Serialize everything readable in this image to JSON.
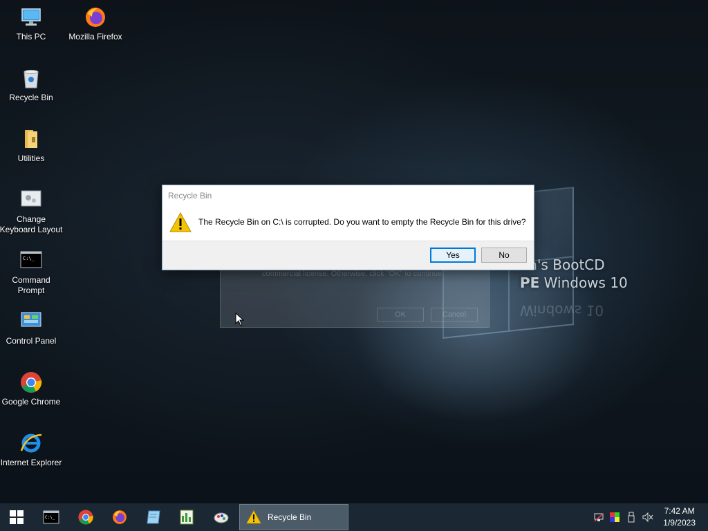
{
  "wallpaper": {
    "line1": "en's BootCD",
    "line2_pe": "PE",
    "line2_rest": " Windows 10",
    "reflection": "Windows 10"
  },
  "ghost_dialog": {
    "text": "EasyBCD Community Edition is freely licensed for non-commercial use. If you are using this software in a commercial environment, please click \"Cancel\" below to purchase a commercial license. Otherwise, click \"OK\" to continue.",
    "ok_label": "OK",
    "cancel_label": "Cancel"
  },
  "desktop_icons": [
    {
      "label": "This PC",
      "icon": "this-pc-icon"
    },
    {
      "label": "Mozilla Firefox",
      "icon": "firefox-icon"
    },
    {
      "label": "Recycle Bin",
      "icon": "recycle-bin-icon"
    },
    {
      "label": "Utilities",
      "icon": "folder-icon"
    },
    {
      "label": "Change Keyboard Layout",
      "icon": "keyboard-layout-icon"
    },
    {
      "label": "Command Prompt",
      "icon": "command-prompt-icon"
    },
    {
      "label": "Control Panel",
      "icon": "control-panel-icon"
    },
    {
      "label": "Google Chrome",
      "icon": "chrome-icon"
    },
    {
      "label": "Internet Explorer",
      "icon": "internet-explorer-icon"
    }
  ],
  "dialog": {
    "title": "Recycle Bin",
    "message": "The Recycle Bin on C:\\ is corrupted. Do you want to empty the Recycle Bin for this drive?",
    "yes_label": "Yes",
    "no_label": "No",
    "icon": "warning-icon"
  },
  "taskbar": {
    "pinned": [
      "start-icon",
      "command-prompt-icon",
      "chrome-icon",
      "firefox-icon",
      "notepad-icon",
      "spreadsheet-icon",
      "paint-icon"
    ],
    "active_window_label": "Recycle Bin",
    "tray_icons": [
      "network-icon",
      "color-icon",
      "usb-icon",
      "volume-muted-icon"
    ],
    "time": "7:42 AM",
    "date": "1/9/2023"
  },
  "colors": {
    "accent": "#0078d7",
    "taskbar": "#1b2833",
    "warning": "#f5c400"
  }
}
